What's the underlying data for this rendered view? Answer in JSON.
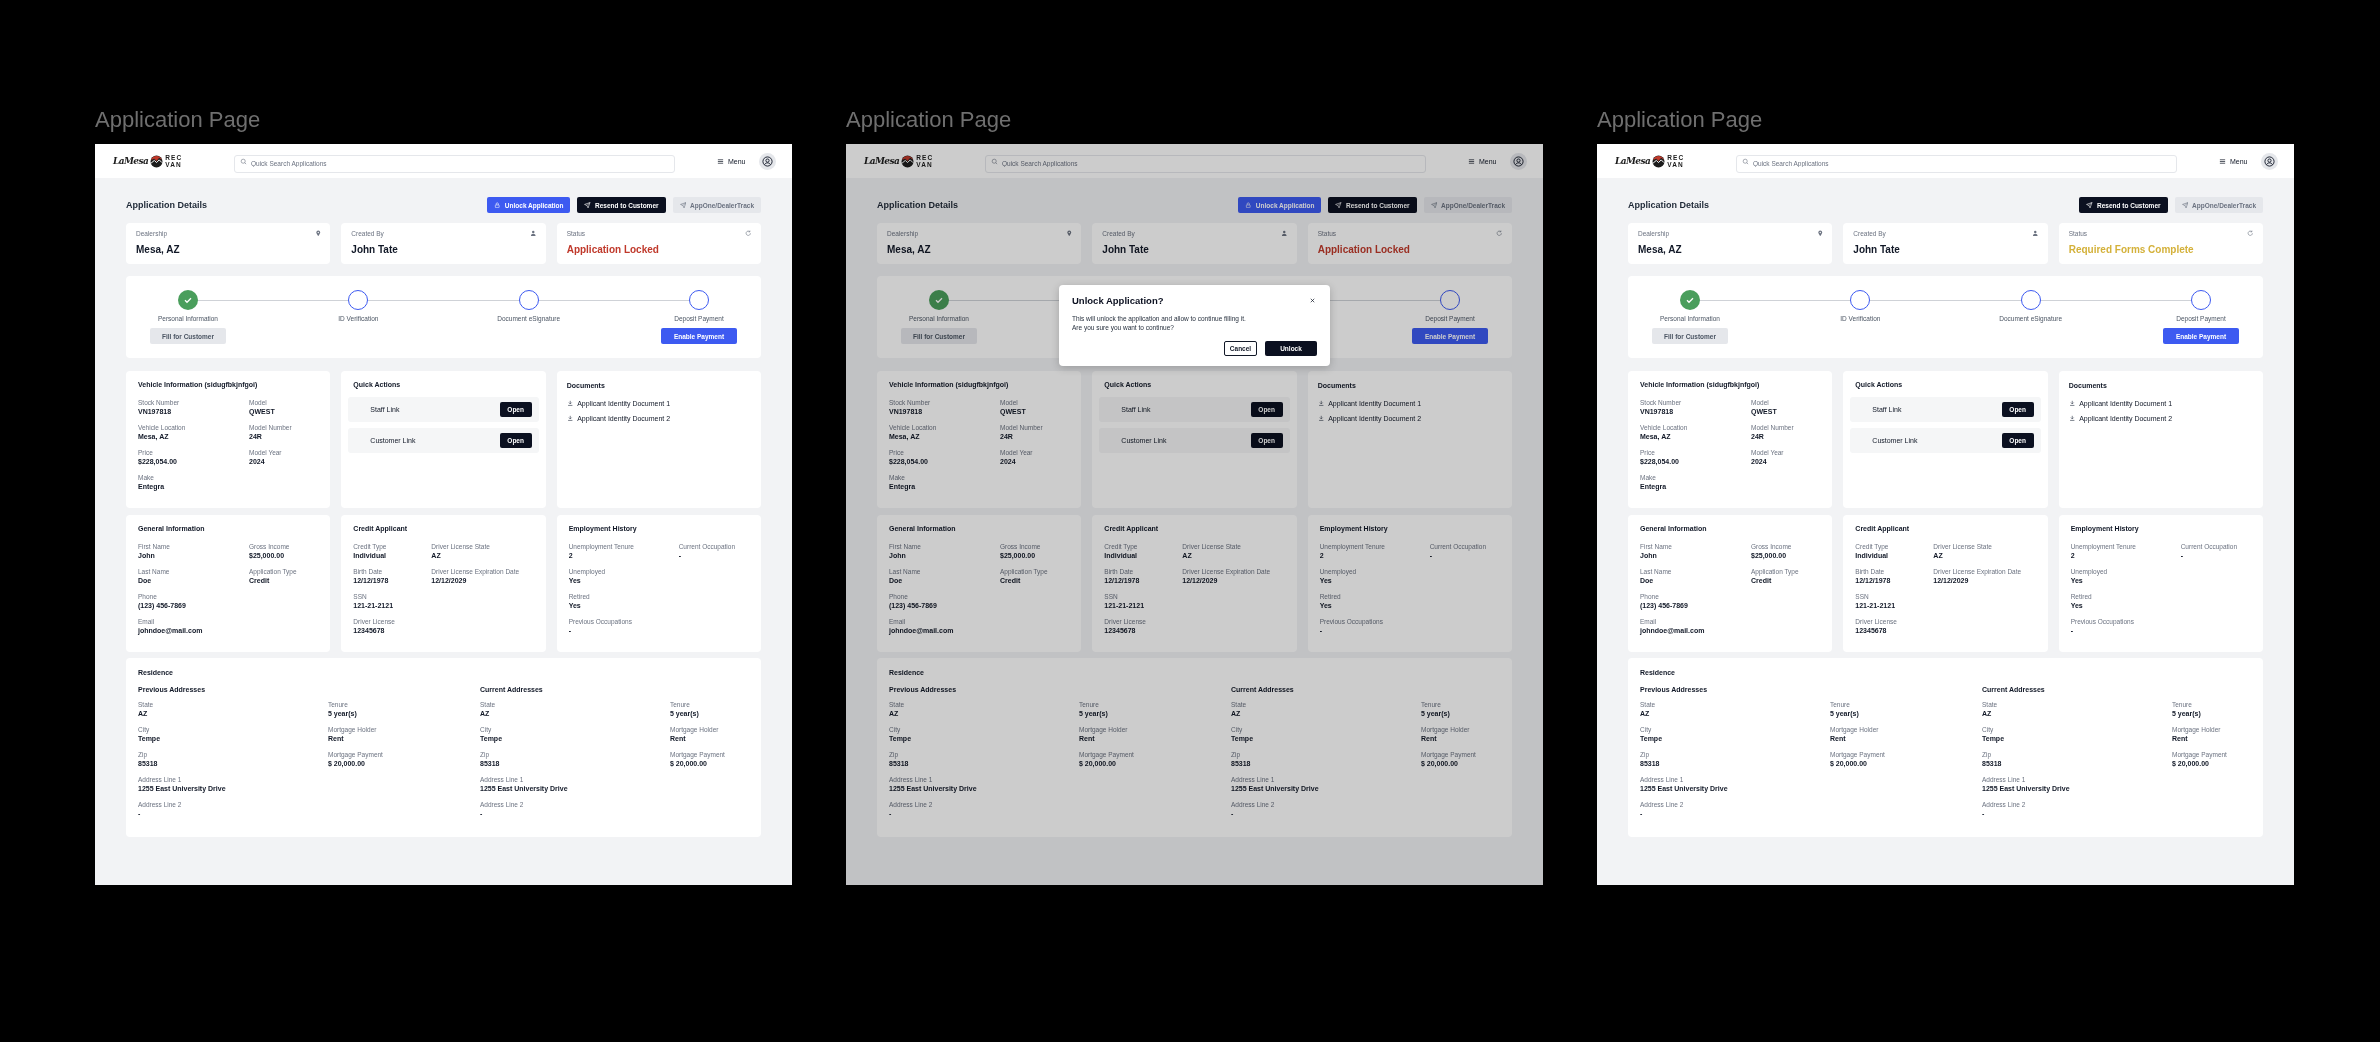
{
  "frames": [
    {
      "label": "Application Page",
      "dimmed": false,
      "header": {
        "logo": {
          "script": "LaMesa",
          "top": "REC",
          "bottom": "VAN"
        },
        "search_placeholder": "Quick Search Applications",
        "menu": "Menu"
      },
      "title": "Application Details",
      "actions": [
        {
          "label": "Unlock Application",
          "kind": "primary"
        },
        {
          "label": "Resend to Customer",
          "kind": "dark"
        },
        {
          "label": "AppOne/DealerTrack",
          "kind": "disabled"
        }
      ],
      "summary": [
        {
          "label": "Dealership",
          "value": "Mesa, AZ",
          "color": "#111827"
        },
        {
          "label": "Created By",
          "value": "John Tate",
          "color": "#111827"
        },
        {
          "label": "Status",
          "value": "Application Locked",
          "color": "#c0392b"
        }
      ],
      "steps": [
        {
          "label": "Personal Information",
          "done": true,
          "button": {
            "label": "Fill for Customer",
            "kind": "muted"
          }
        },
        {
          "label": "ID Verification",
          "done": false
        },
        {
          "label": "Document eSignature",
          "done": false
        },
        {
          "label": "Deposit Payment",
          "done": false,
          "button": {
            "label": "Enable Payment",
            "kind": "primary"
          }
        }
      ],
      "vehicle": {
        "title": "Vehicle Information (sidugfbkjnfgoi)",
        "columns": [
          [
            {
              "label": "Stock Number",
              "value": "VN197818"
            },
            {
              "label": "Vehicle Location",
              "value": "Mesa, AZ"
            },
            {
              "label": "Price",
              "value": "$228,054.00"
            },
            {
              "label": "Make",
              "value": "Entegra"
            }
          ],
          [
            {
              "label": "Model",
              "value": "QWEST"
            },
            {
              "label": "Model Number",
              "value": "24R"
            },
            {
              "label": "Model Year",
              "value": "2024"
            }
          ]
        ]
      },
      "quick_actions": {
        "title": "Quick Actions",
        "items": [
          {
            "label": "Staff Link",
            "button": "Open"
          },
          {
            "label": "Customer Link",
            "button": "Open"
          }
        ]
      },
      "documents": {
        "title": "Documents",
        "items": [
          "Applicant Identity Document 1",
          "Applicant Identity Document 2"
        ]
      },
      "general": {
        "title": "General Information",
        "columns": [
          [
            {
              "label": "First Name",
              "value": "John"
            },
            {
              "label": "Last Name",
              "value": "Doe"
            },
            {
              "label": "Phone",
              "value": "(123) 456-7869"
            },
            {
              "label": "Email",
              "value": "johndoe@mail.com"
            }
          ],
          [
            {
              "label": "Gross Income",
              "value": "$25,000.00"
            },
            {
              "label": "Application Type",
              "value": "Credit"
            }
          ]
        ]
      },
      "credit": {
        "title": "Credit Applicant",
        "columns": [
          [
            {
              "label": "Credit Type",
              "value": "Individual"
            },
            {
              "label": "Birth Date",
              "value": "12/12/1978"
            },
            {
              "label": "SSN",
              "value": "121-21-2121"
            },
            {
              "label": "Driver License",
              "value": "12345678"
            }
          ],
          [
            {
              "label": "Driver License State",
              "value": "AZ"
            },
            {
              "label": "Driver License Expiration Date",
              "value": "12/12/2029"
            }
          ]
        ]
      },
      "employment": {
        "title": "Employment History",
        "columns": [
          [
            {
              "label": "Unemployment Tenure",
              "value": "2"
            },
            {
              "label": "Unemployed",
              "value": "Yes"
            },
            {
              "label": "Retired",
              "value": "Yes"
            },
            {
              "label": "Previous Occupations",
              "value": "-"
            }
          ],
          [
            {
              "label": "Current Occupation",
              "value": "-"
            }
          ]
        ]
      },
      "residence": {
        "title": "Residence",
        "groups": [
          {
            "title": "Previous Addresses",
            "columns": [
              [
                {
                  "label": "State",
                  "value": "AZ"
                },
                {
                  "label": "City",
                  "value": "Tempe"
                },
                {
                  "label": "Zip",
                  "value": "85318"
                },
                {
                  "label": "Address Line 1",
                  "value": "1255 East University Drive"
                },
                {
                  "label": "Address Line 2",
                  "value": "-"
                }
              ],
              [
                {
                  "label": "Tenure",
                  "value": "5 year(s)"
                },
                {
                  "label": "Mortgage Holder",
                  "value": "Rent"
                },
                {
                  "label": "Mortgage Payment",
                  "value": "$ 20,000.00"
                }
              ]
            ]
          },
          {
            "title": "Current Addresses",
            "columns": [
              [
                {
                  "label": "State",
                  "value": "AZ"
                },
                {
                  "label": "City",
                  "value": "Tempe"
                },
                {
                  "label": "Zip",
                  "value": "85318"
                },
                {
                  "label": "Address Line 1",
                  "value": "1255 East University Drive"
                },
                {
                  "label": "Address Line 2",
                  "value": "-"
                }
              ],
              [
                {
                  "label": "Tenure",
                  "value": "5 year(s)"
                },
                {
                  "label": "Mortgage Holder",
                  "value": "Rent"
                },
                {
                  "label": "Mortgage Payment",
                  "value": "$ 20,000.00"
                }
              ]
            ]
          }
        ]
      }
    },
    {
      "label": "Application Page",
      "dimmed": true,
      "header": {
        "logo": {
          "script": "LaMesa",
          "top": "REC",
          "bottom": "VAN"
        },
        "search_placeholder": "Quick Search Applications",
        "menu": "Menu"
      },
      "title": "Application Details",
      "actions": [
        {
          "label": "Unlock Application",
          "kind": "primary"
        },
        {
          "label": "Resend to Customer",
          "kind": "dark"
        },
        {
          "label": "AppOne/DealerTrack",
          "kind": "disabled"
        }
      ],
      "summary": [
        {
          "label": "Dealership",
          "value": "Mesa, AZ",
          "color": "#0e131f"
        },
        {
          "label": "Created By",
          "value": "John Tate",
          "color": "#0e131f"
        },
        {
          "label": "Status",
          "value": "Application Locked",
          "color": "#9a2e22"
        }
      ],
      "steps": [
        {
          "label": "Personal Information",
          "done": true,
          "button": {
            "label": "Fill for Customer",
            "kind": "muted"
          }
        },
        {
          "label": "Deposit Payment",
          "done": false,
          "button": {
            "label": "Enable Payment",
            "kind": "primary"
          }
        }
      ],
      "vehicle": {
        "title": "Vehicle Information (sidugfbkjnfgoi)",
        "columns": [
          [
            {
              "label": "Stock Number",
              "value": "VN197818"
            },
            {
              "label": "Vehicle Location",
              "value": "Mesa, AZ"
            },
            {
              "label": "Price",
              "value": "$228,054.00"
            },
            {
              "label": "Make",
              "value": "Entegra"
            }
          ],
          [
            {
              "label": "Model",
              "value": "QWEST"
            },
            {
              "label": "Model Number",
              "value": "24R"
            },
            {
              "label": "Model Year",
              "value": "2024"
            }
          ]
        ]
      },
      "quick_actions": {
        "title": "Quick Actions",
        "items": [
          {
            "label": "Staff Link",
            "button": "Open"
          },
          {
            "label": "Customer Link",
            "button": "Open"
          }
        ]
      },
      "documents": {
        "title": "Documents",
        "items": [
          "Applicant Identity Document 1",
          "Applicant Identity Document 2"
        ]
      },
      "general": {
        "title": "General Information",
        "columns": [
          [
            {
              "label": "First Name",
              "value": "John"
            },
            {
              "label": "Last Name",
              "value": "Doe"
            },
            {
              "label": "Phone",
              "value": "(123) 456-7869"
            },
            {
              "label": "Email",
              "value": "johndoe@mail.com"
            }
          ],
          [
            {
              "label": "Gross Income",
              "value": "$25,000.00"
            },
            {
              "label": "Application Type",
              "value": "Credit"
            }
          ]
        ]
      },
      "credit": {
        "title": "Credit Applicant",
        "columns": [
          [
            {
              "label": "Credit Type",
              "value": "Individual"
            },
            {
              "label": "Birth Date",
              "value": "12/12/1978"
            },
            {
              "label": "SSN",
              "value": "121-21-2121"
            },
            {
              "label": "Driver License",
              "value": "12345678"
            }
          ],
          [
            {
              "label": "Driver License State",
              "value": "AZ"
            },
            {
              "label": "Driver License Expiration Date",
              "value": "12/12/2029"
            }
          ]
        ]
      },
      "employment": {
        "title": "Employment History",
        "columns": [
          [
            {
              "label": "Unemployment Tenure",
              "value": "2"
            },
            {
              "label": "Unemployed",
              "value": "Yes"
            },
            {
              "label": "Retired",
              "value": "Yes"
            },
            {
              "label": "Previous Occupations",
              "value": "-"
            }
          ],
          [
            {
              "label": "Current Occupation",
              "value": "-"
            }
          ]
        ]
      },
      "residence": {
        "title": "Residence",
        "groups": [
          {
            "title": "Previous Addresses",
            "columns": [
              [
                {
                  "label": "State",
                  "value": "AZ"
                },
                {
                  "label": "City",
                  "value": "Tempe"
                },
                {
                  "label": "Zip",
                  "value": "85318"
                },
                {
                  "label": "Address Line 1",
                  "value": "1255 East University Drive"
                },
                {
                  "label": "Address Line 2",
                  "value": "-"
                }
              ],
              [
                {
                  "label": "Tenure",
                  "value": "5 year(s)"
                },
                {
                  "label": "Mortgage Holder",
                  "value": "Rent"
                },
                {
                  "label": "Mortgage Payment",
                  "value": "$ 20,000.00"
                }
              ]
            ]
          },
          {
            "title": "Current Addresses",
            "columns": [
              [
                {
                  "label": "State",
                  "value": "AZ"
                },
                {
                  "label": "City",
                  "value": "Tempe"
                },
                {
                  "label": "Zip",
                  "value": "85318"
                },
                {
                  "label": "Address Line 1",
                  "value": "1255 East University Drive"
                },
                {
                  "label": "Address Line 2",
                  "value": "-"
                }
              ],
              [
                {
                  "label": "Tenure",
                  "value": "5 year(s)"
                },
                {
                  "label": "Mortgage Holder",
                  "value": "Rent"
                },
                {
                  "label": "Mortgage Payment",
                  "value": "$ 20,000.00"
                }
              ]
            ]
          }
        ]
      },
      "modal": {
        "title": "Unlock Application?",
        "lines": [
          "This will unlock the application and allow to continue filling it.",
          "Are you sure you want to continue?"
        ],
        "buttons": [
          {
            "label": "Cancel",
            "kind": "outline"
          },
          {
            "label": "Unlock",
            "kind": "dark"
          }
        ]
      }
    },
    {
      "label": "Application Page",
      "dimmed": false,
      "header": {
        "logo": {
          "script": "LaMesa",
          "top": "REC",
          "bottom": "VAN"
        },
        "search_placeholder": "Quick Search Applications",
        "menu": "Menu"
      },
      "title": "Application Details",
      "actions": [
        {
          "label": "Resend to Customer",
          "kind": "dark"
        },
        {
          "label": "AppOne/DealerTrack",
          "kind": "disabled"
        }
      ],
      "summary": [
        {
          "label": "Dealership",
          "value": "Mesa, AZ",
          "color": "#111827"
        },
        {
          "label": "Created By",
          "value": "John Tate",
          "color": "#111827"
        },
        {
          "label": "Status",
          "value": "Required Forms Complete",
          "color": "#d4b13a"
        }
      ],
      "steps": [
        {
          "label": "Personal Information",
          "done": true,
          "button": {
            "label": "Fill for Customer",
            "kind": "muted"
          }
        },
        {
          "label": "ID Verification",
          "done": false
        },
        {
          "label": "Document eSignature",
          "done": false
        },
        {
          "label": "Deposit Payment",
          "done": false,
          "button": {
            "label": "Enable Payment",
            "kind": "primary"
          }
        }
      ],
      "vehicle": {
        "title": "Vehicle Information (sidugfbkjnfgoi)",
        "columns": [
          [
            {
              "label": "Stock Number",
              "value": "VN197818"
            },
            {
              "label": "Vehicle Location",
              "value": "Mesa, AZ"
            },
            {
              "label": "Price",
              "value": "$228,054.00"
            },
            {
              "label": "Make",
              "value": "Entegra"
            }
          ],
          [
            {
              "label": "Model",
              "value": "QWEST"
            },
            {
              "label": "Model Number",
              "value": "24R"
            },
            {
              "label": "Model Year",
              "value": "2024"
            }
          ]
        ]
      },
      "quick_actions": {
        "title": "Quick Actions",
        "items": [
          {
            "label": "Staff Link",
            "button": "Open"
          },
          {
            "label": "Customer Link",
            "button": "Open"
          }
        ]
      },
      "documents": {
        "title": "Documents",
        "items": [
          "Applicant Identity Document 1",
          "Applicant Identity Document 2"
        ]
      },
      "general": {
        "title": "General Information",
        "columns": [
          [
            {
              "label": "First Name",
              "value": "John"
            },
            {
              "label": "Last Name",
              "value": "Doe"
            },
            {
              "label": "Phone",
              "value": "(123) 456-7869"
            },
            {
              "label": "Email",
              "value": "johndoe@mail.com"
            }
          ],
          [
            {
              "label": "Gross Income",
              "value": "$25,000.00"
            },
            {
              "label": "Application Type",
              "value": "Credit"
            }
          ]
        ]
      },
      "credit": {
        "title": "Credit Applicant",
        "columns": [
          [
            {
              "label": "Credit Type",
              "value": "Individual"
            },
            {
              "label": "Birth Date",
              "value": "12/12/1978"
            },
            {
              "label": "SSN",
              "value": "121-21-2121"
            },
            {
              "label": "Driver License",
              "value": "12345678"
            }
          ],
          [
            {
              "label": "Driver License State",
              "value": "AZ"
            },
            {
              "label": "Driver License Expiration Date",
              "value": "12/12/2029"
            }
          ]
        ]
      },
      "employment": {
        "title": "Employment History",
        "columns": [
          [
            {
              "label": "Unemployment Tenure",
              "value": "2"
            },
            {
              "label": "Unemployed",
              "value": "Yes"
            },
            {
              "label": "Retired",
              "value": "Yes"
            },
            {
              "label": "Previous Occupations",
              "value": "-"
            }
          ],
          [
            {
              "label": "Current Occupation",
              "value": "-"
            }
          ]
        ]
      },
      "residence": {
        "title": "Residence",
        "groups": [
          {
            "title": "Previous Addresses",
            "columns": [
              [
                {
                  "label": "State",
                  "value": "AZ"
                },
                {
                  "label": "City",
                  "value": "Tempe"
                },
                {
                  "label": "Zip",
                  "value": "85318"
                },
                {
                  "label": "Address Line 1",
                  "value": "1255 East University Drive"
                },
                {
                  "label": "Address Line 2",
                  "value": "-"
                }
              ],
              [
                {
                  "label": "Tenure",
                  "value": "5 year(s)"
                },
                {
                  "label": "Mortgage Holder",
                  "value": "Rent"
                },
                {
                  "label": "Mortgage Payment",
                  "value": "$ 20,000.00"
                }
              ]
            ]
          },
          {
            "title": "Current Addresses",
            "columns": [
              [
                {
                  "label": "State",
                  "value": "AZ"
                },
                {
                  "label": "City",
                  "value": "Tempe"
                },
                {
                  "label": "Zip",
                  "value": "85318"
                },
                {
                  "label": "Address Line 1",
                  "value": "1255 East University Drive"
                },
                {
                  "label": "Address Line 2",
                  "value": "-"
                }
              ],
              [
                {
                  "label": "Tenure",
                  "value": "5 year(s)"
                },
                {
                  "label": "Mortgage Holder",
                  "value": "Rent"
                },
                {
                  "label": "Mortgage Payment",
                  "value": "$ 20,000.00"
                }
              ]
            ]
          }
        ]
      }
    }
  ]
}
